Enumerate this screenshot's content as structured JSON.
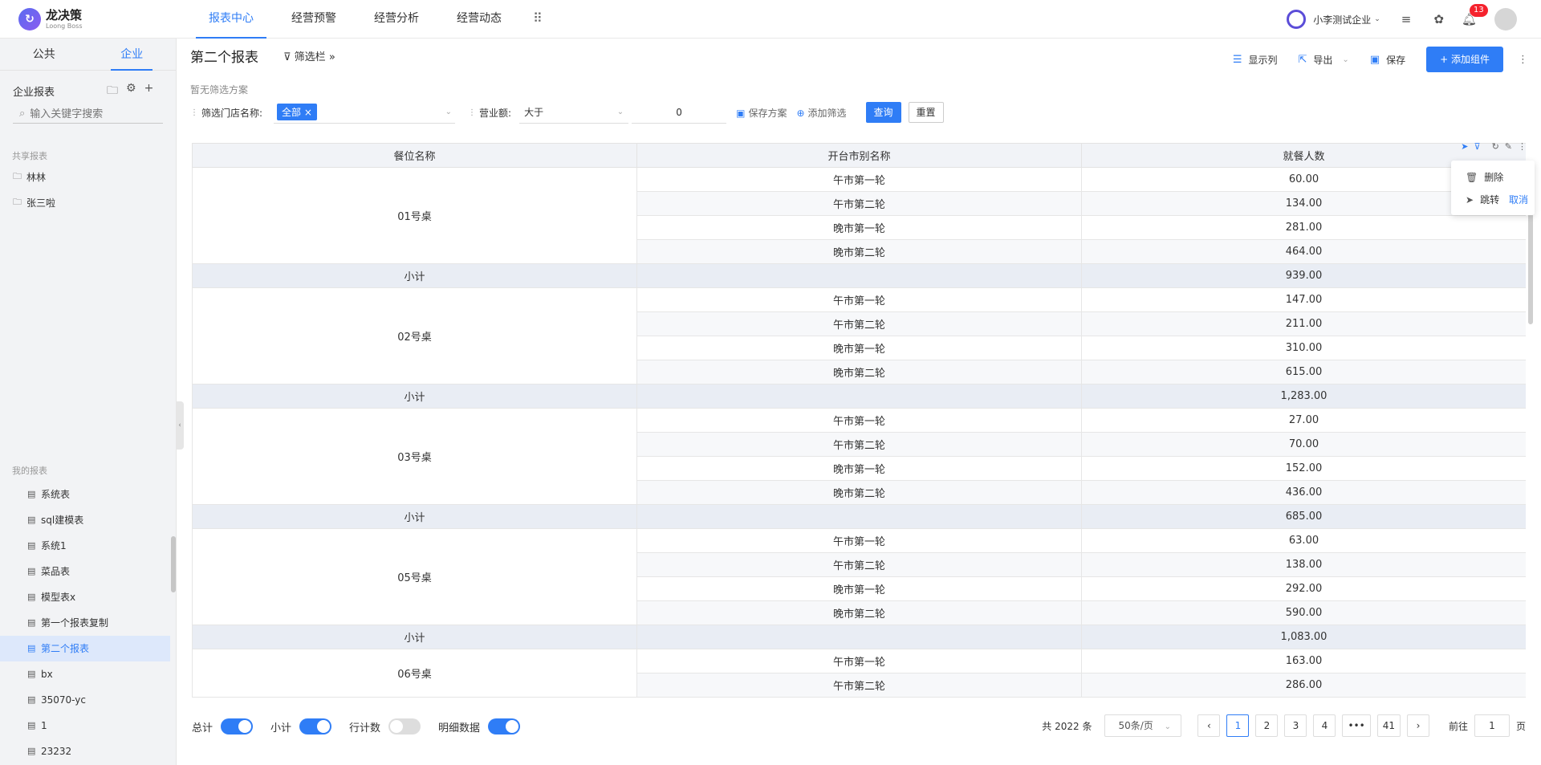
{
  "app": {
    "logo_cn": "龙决策",
    "logo_en": "Loong Boss"
  },
  "nav": {
    "items": [
      "报表中心",
      "经营预警",
      "经营分析",
      "经营动态"
    ],
    "active": 0
  },
  "topbar": {
    "enterprise": "小李测试企业",
    "notification_count": "13"
  },
  "sidebar": {
    "tabs": [
      "公共",
      "企业"
    ],
    "active_tab": 1,
    "header": "企业报表",
    "search_placeholder": "输入关键字搜索",
    "shared_section": "共享报表",
    "shared_folders": [
      "林林",
      "张三啦"
    ],
    "my_section": "我的报表",
    "my_reports": [
      "系统表",
      "sql建模表",
      "系统1",
      "菜品表",
      "模型表x",
      "第一个报表复制",
      "第二个报表",
      "bx",
      "35070-yc",
      "1",
      "23232"
    ],
    "active_report": 6
  },
  "main": {
    "title": "第二个报表",
    "filter_toggle": "筛选栏",
    "no_scheme": "暂无筛选方案",
    "tools": {
      "columns": "显示列",
      "export": "导出",
      "save": "保存",
      "add": "+ 添加组件"
    }
  },
  "filters": {
    "store_label": "筛选门店名称:",
    "store_tag": "全部",
    "revenue_label": "营业额:",
    "op": "大于",
    "value": "0",
    "save_scheme": "保存方案",
    "add_filter": "添加筛选",
    "query": "查询",
    "reset": "重置"
  },
  "table": {
    "headers": [
      "餐位名称",
      "开台市别名称",
      "就餐人数"
    ],
    "subtotal_label": "小计",
    "groups": [
      {
        "name": "01号桌",
        "rows": [
          [
            "午市第一轮",
            "60.00"
          ],
          [
            "午市第二轮",
            "134.00"
          ],
          [
            "晚市第一轮",
            "281.00"
          ],
          [
            "晚市第二轮",
            "464.00"
          ]
        ],
        "subtotal": "939.00"
      },
      {
        "name": "02号桌",
        "rows": [
          [
            "午市第一轮",
            "147.00"
          ],
          [
            "午市第二轮",
            "211.00"
          ],
          [
            "晚市第一轮",
            "310.00"
          ],
          [
            "晚市第二轮",
            "615.00"
          ]
        ],
        "subtotal": "1,283.00"
      },
      {
        "name": "03号桌",
        "rows": [
          [
            "午市第一轮",
            "27.00"
          ],
          [
            "午市第二轮",
            "70.00"
          ],
          [
            "晚市第一轮",
            "152.00"
          ],
          [
            "晚市第二轮",
            "436.00"
          ]
        ],
        "subtotal": "685.00"
      },
      {
        "name": "05号桌",
        "rows": [
          [
            "午市第一轮",
            "63.00"
          ],
          [
            "午市第二轮",
            "138.00"
          ],
          [
            "晚市第一轮",
            "292.00"
          ],
          [
            "晚市第二轮",
            "590.00"
          ]
        ],
        "subtotal": "1,083.00"
      },
      {
        "name": "06号桌",
        "rows": [
          [
            "午市第一轮",
            "163.00"
          ],
          [
            "午市第二轮",
            "286.00"
          ]
        ],
        "subtotal": null
      }
    ]
  },
  "context_menu": {
    "delete": "删除",
    "jump": "跳转",
    "cancel": "取消"
  },
  "footer": {
    "toggles": [
      {
        "label": "总计",
        "on": true
      },
      {
        "label": "小计",
        "on": true
      },
      {
        "label": "行计数",
        "on": false
      },
      {
        "label": "明细数据",
        "on": true
      }
    ],
    "total": "共 2022 条",
    "per_page": "50条/页",
    "pages": [
      "1",
      "2",
      "3",
      "4",
      "•••",
      "41"
    ],
    "current_page": "1",
    "goto_label": "前往",
    "goto_value": "1",
    "page_suffix": "页"
  },
  "colors": {
    "accent": "#2f7df6",
    "badge": "#f5222d"
  }
}
